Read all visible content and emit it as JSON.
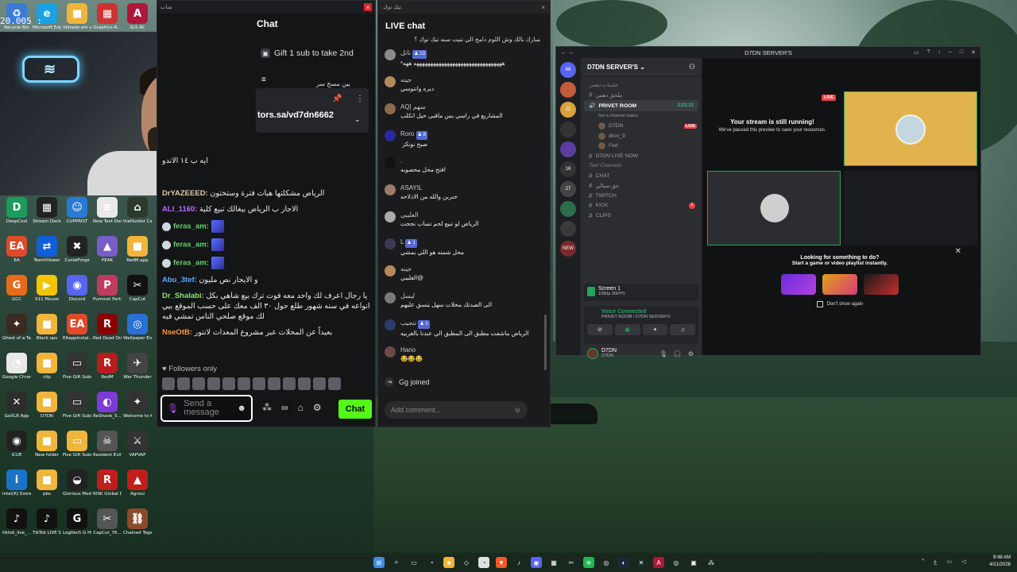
{
  "overlay": {
    "timer": "20.005 :"
  },
  "desktop": {
    "icons": [
      {
        "label": "Recycle Bin",
        "color": "#3a7bd5",
        "glyph": "♻"
      },
      {
        "label": "Microsoft Edge",
        "color": "#1ba1e2",
        "glyph": "e"
      },
      {
        "label": "Vidrado em voce",
        "color": "#f0b53a",
        "glyph": "■"
      },
      {
        "label": "Graphics-R...",
        "color": "#c33",
        "glyph": "▦"
      },
      {
        "label": "SLS AC",
        "color": "#b0153a",
        "glyph": "A"
      },
      {
        "label": "DeepCool",
        "color": "#1c9c5c",
        "glyph": "D"
      },
      {
        "label": "Stream Deck",
        "color": "#222",
        "glyph": "▦"
      },
      {
        "label": "CUPPRIST",
        "color": "#2a7ad5",
        "glyph": "☺"
      },
      {
        "label": "New Text Document",
        "color": "#e9e9e9",
        "glyph": "≡"
      },
      {
        "label": "theHunter Call of t...",
        "color": "#2c3a2b",
        "glyph": "⌂"
      },
      {
        "label": "EA",
        "color": "#e04a2a",
        "glyph": "EA"
      },
      {
        "label": "TeamViewer",
        "color": "#0e5fd8",
        "glyph": "⇄"
      },
      {
        "label": "CurseForge",
        "color": "#222",
        "glyph": "✖"
      },
      {
        "label": "PEAK",
        "color": "#7a5cc7",
        "glyph": "▲"
      },
      {
        "label": "RedM.app",
        "color": "#f0b53a",
        "glyph": "■"
      },
      {
        "label": "GCC",
        "color": "#e86b1a",
        "glyph": "G"
      },
      {
        "label": "X11 Mouse",
        "color": "#f5c400",
        "glyph": "▶"
      },
      {
        "label": "Discord",
        "color": "#5865f2",
        "glyph": "◉"
      },
      {
        "label": "Pummel Party",
        "color": "#c23b5f",
        "glyph": "P"
      },
      {
        "label": "CapCut",
        "color": "#111",
        "glyph": "✂"
      },
      {
        "label": "Ghost of a Tale",
        "color": "#3b2a22",
        "glyph": "✦"
      },
      {
        "label": "Black ops",
        "color": "#f0b53a",
        "glyph": "■"
      },
      {
        "label": "EAappinstal...",
        "color": "#e04a2a",
        "glyph": "EA"
      },
      {
        "label": "Red Dead Online",
        "color": "#8b0000",
        "glyph": "R"
      },
      {
        "label": "Wallpaper Engine",
        "color": "#2a6fd6",
        "glyph": "◎"
      },
      {
        "label": "Google Chrome",
        "color": "#e8e8e8",
        "glyph": "◔"
      },
      {
        "label": "clip",
        "color": "#f0b53a",
        "glyph": "■"
      },
      {
        "label": "Five Gift Subs (1)",
        "color": "#333",
        "glyph": "▭"
      },
      {
        "label": "RedM",
        "color": "#b81d1d",
        "glyph": "R"
      },
      {
        "label": "War Thunder",
        "color": "#444",
        "glyph": "✈"
      },
      {
        "label": "GoXLR App",
        "color": "#2d2d2d",
        "glyph": "✕"
      },
      {
        "label": "D7DN",
        "color": "#f0b53a",
        "glyph": "■"
      },
      {
        "label": "Five Gift Subs",
        "color": "#333",
        "glyph": "▭"
      },
      {
        "label": "ReShade_5...",
        "color": "#7a3bd6",
        "glyph": "◐"
      },
      {
        "label": "Welcome to Kowloon",
        "color": "#333",
        "glyph": "✦"
      },
      {
        "label": "iCUE",
        "color": "#222",
        "glyph": "◉"
      },
      {
        "label": "New folder",
        "color": "#f0b53a",
        "glyph": "■"
      },
      {
        "label": "Five Gift Subs-2025...",
        "color": "#f0b53a",
        "glyph": "▭"
      },
      {
        "label": "Resident Evil Requiem",
        "color": "#555",
        "glyph": "☠"
      },
      {
        "label": "VAPVAP",
        "color": "#333",
        "glyph": "⚔"
      },
      {
        "label": "Intel(R) Extre...",
        "color": "#1a73c7",
        "glyph": "i"
      },
      {
        "label": "pbs",
        "color": "#f0b53a",
        "glyph": "■"
      },
      {
        "label": "Glorious Model ...",
        "color": "#222",
        "glyph": "◒"
      },
      {
        "label": "RISK Global Domination",
        "color": "#c21d1d",
        "glyph": "R"
      },
      {
        "label": "Agroul",
        "color": "#c21d1d",
        "glyph": "▲"
      },
      {
        "label": "tiktok_live_...",
        "color": "#111",
        "glyph": "♪"
      },
      {
        "label": "TikTok LIVE Studio",
        "color": "#111",
        "glyph": "♪"
      },
      {
        "label": "Logitech G HUB",
        "color": "#111",
        "glyph": "G"
      },
      {
        "label": "CapCut_76...",
        "color": "#555",
        "glyph": "✂"
      },
      {
        "label": "Chained Together",
        "color": "#8a4b2a",
        "glyph": "⛓"
      }
    ]
  },
  "kick": {
    "window_title": "شات",
    "title": "Chat",
    "gift_text": "Gift 1 sub to take 2nd",
    "pinned_note": "بين مسخ سر",
    "pinned_link": "tors.sa/vd7dn6662",
    "messages": [
      {
        "user": "",
        "text": "ايه ب ١٤ الاندو",
        "color": "#ffffff"
      },
      {
        "user": "DrYAZEEED",
        "text": "الرياض مشكلتها هبات فترة وستختون",
        "color": "#e3c9a0"
      },
      {
        "user": "ALI_1160",
        "text": "الاجار ب الرياض بيغالك تبيع كلية",
        "color": "#b56cff"
      },
      {
        "user": "feras_am",
        "text": "",
        "color": "#66d36e"
      },
      {
        "user": "feras_am",
        "text": "",
        "color": "#66d36e"
      },
      {
        "user": "feras_am",
        "text": "",
        "color": "#66d36e"
      },
      {
        "user": "Abu_3tef",
        "text": "و الايجار نص مليون",
        "color": "#5aa9ff"
      },
      {
        "user": "Dr_Shalabi",
        "text": "يا رجال اعرف لك واحد معه فوت ترك بيع شاهي بكل انواعه في سنه شهور طلع حول ٣٠ الف معك على حسب الموقع بيي لك موقع صلحي الناس تمشي فيه",
        "color": "#8de36b"
      },
      {
        "user": "NseOtB",
        "text": "بعيداً عن المحلات عبر مشروع المعدات لانتور",
        "color": "#ff9a3c"
      }
    ],
    "followers_label": "Followers only",
    "input_placeholder": "Send a message",
    "chat_button": "Chat"
  },
  "tiktok": {
    "window_title": "تيك توك",
    "title": "LIVE chat",
    "pinned": "مبارك بالك وش اللوم دامج الي نتيت سنه تيك توك ؟",
    "messages": [
      {
        "name": "ناتل",
        "level": "13",
        "text": "ههههههههههههههههههههههههههههههههه ههه*",
        "avatar": "#8a8a8a"
      },
      {
        "name": "جينه",
        "level": "",
        "text": "ديره وانتوسي",
        "avatar": "#b58a5a"
      },
      {
        "name": "AQ| سهم",
        "level": "",
        "text": "المشاريع في راسي بس ماقبي حيل اتكلب",
        "avatar": "#8b6b50"
      },
      {
        "name": "Roro",
        "level": "8",
        "text": "صبح نونكز",
        "avatar": "#2a2aa0"
      },
      {
        "name": ".",
        "level": "",
        "text": "افتح محل محصوبه",
        "avatar": "#111111"
      },
      {
        "name": "ASAYIL",
        "level": "",
        "text": "حنرين والله من الاذلاحه",
        "avatar": "#9a7a6a"
      },
      {
        "name": "العليبي",
        "level": "",
        "text": "الرياض لو تبيع لحم تساب نجحت",
        "avatar": "#aaaaaa"
      },
      {
        "name": "L",
        "level": "1",
        "text": "محل شمته هو اللي بمشي",
        "avatar": "#3a3a55"
      },
      {
        "name": "جينه",
        "level": "",
        "text": "@العليبي",
        "avatar": "#b58a5a"
      },
      {
        "name": "ليسل",
        "level": "",
        "text": "الى الصدتك مخلات سهل يتسق عليهم",
        "avatar": "#7a7a7a"
      },
      {
        "name": "تنجيب",
        "level": "1",
        "text": "الرياض ماشفت مطبق الى المطبق الي عندنا بالغربيه",
        "avatar": "#2a3a6a"
      },
      {
        "name": "Hano",
        "level": "",
        "text": "😂😂😂",
        "avatar": "#6a4a4a"
      }
    ],
    "joined_text": "Gg joined",
    "comment_placeholder": "Add comment..."
  },
  "discord": {
    "window_title": "D7DN SERVER'S",
    "server_name": "D7DN SERVER'S",
    "rows": [
      {
        "kind": "cat",
        "label": "جلسات دهمن",
        "extra": ""
      },
      {
        "kind": "ch",
        "label": "ملحق دهمن",
        "extra": ""
      },
      {
        "kind": "hl",
        "label": "PRIVET ROOM",
        "extra": "3:23:13"
      },
      {
        "kind": "sub",
        "label": "Set a channel status",
        "extra": ""
      },
      {
        "kind": "user",
        "label": "D7DN",
        "extra": "LIVE"
      },
      {
        "kind": "user",
        "label": "dhm_9",
        "extra": ""
      },
      {
        "kind": "user",
        "label": "Fed",
        "extra": ""
      },
      {
        "kind": "ch",
        "label": "D7DN LIVE NOW",
        "extra": ""
      },
      {
        "kind": "cat",
        "label": "Text Channels",
        "extra": ""
      },
      {
        "kind": "ch",
        "label": "CHAT",
        "extra": ""
      },
      {
        "kind": "ch",
        "label": "حق-سبالي",
        "extra": ""
      },
      {
        "kind": "ch",
        "label": "TWITCH",
        "extra": ""
      },
      {
        "kind": "ch",
        "label": "KICK",
        "extra": "1"
      },
      {
        "kind": "ch",
        "label": "CLIPS",
        "extra": ""
      }
    ],
    "rail": [
      "88",
      "",
      "22",
      "",
      "",
      "16",
      "27",
      "",
      "",
      "NEW"
    ],
    "screen_title": "Screen 1",
    "screen_sub": "1080p 30FPS",
    "voice_title": "Voice Connected",
    "voice_sub": "PRIVET ROOM / D7DN SERVER'S",
    "user_name": "D7DN",
    "user_status": "D7DN",
    "stream_title": "Your stream is still running!",
    "stream_sub": "We've paused this preview to save your resources.",
    "live_label": "LIVE",
    "promo_title": "Looking for something to do?",
    "promo_sub": "Start a game or video playlist instantly.",
    "dont_show": "Don't show again"
  },
  "taskbar": {
    "time": "9:48 AM",
    "date": "4/21/2026",
    "lang": "ع"
  }
}
